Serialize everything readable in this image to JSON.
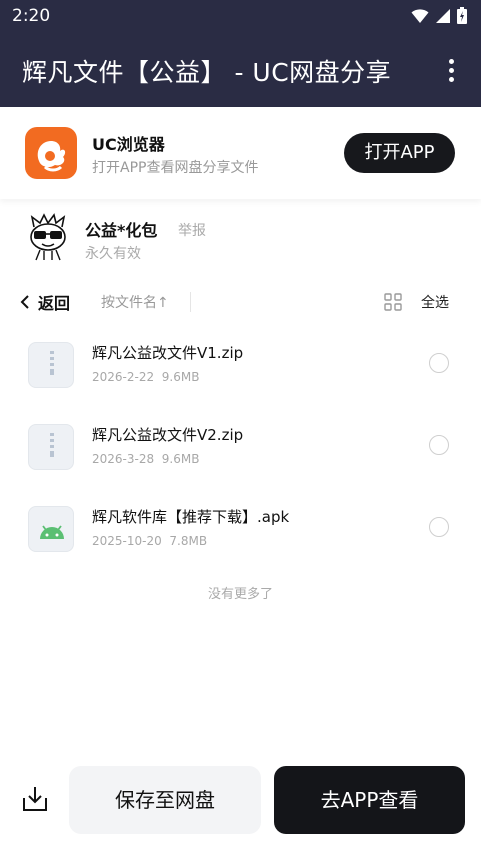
{
  "status_bar": {
    "time": "2:20"
  },
  "app_bar": {
    "title": "辉凡文件【公益】 - UC网盘分享"
  },
  "promo": {
    "app_name": "UC浏览器",
    "description": "打开APP查看网盘分享文件",
    "open_button": "打开APP"
  },
  "sharer": {
    "name": "公益*化包",
    "report": "举报",
    "validity": "永久有效"
  },
  "toolbar": {
    "back": "返回",
    "sort": "按文件名↑",
    "select_all": "全选"
  },
  "files": [
    {
      "name": "辉凡公益改文件V1.zip",
      "date": "2026-2-22",
      "size": "9.6MB",
      "icon": "zip-file-icon"
    },
    {
      "name": "辉凡公益改文件V2.zip",
      "date": "2026-3-28",
      "size": "9.6MB",
      "icon": "zip-file-icon"
    },
    {
      "name": "辉凡软件库【推荐下载】.apk",
      "date": "2025-10-20",
      "size": "7.8MB",
      "icon": "android-apk-icon"
    }
  ],
  "list_end": "没有更多了",
  "bottom_bar": {
    "save_button": "保存至网盘",
    "app_button": "去APP查看"
  },
  "colors": {
    "header_bg": "#2a2c44",
    "uc_orange": "#f26b21",
    "dark_button": "#17181c",
    "android_green": "#5bbf73"
  }
}
